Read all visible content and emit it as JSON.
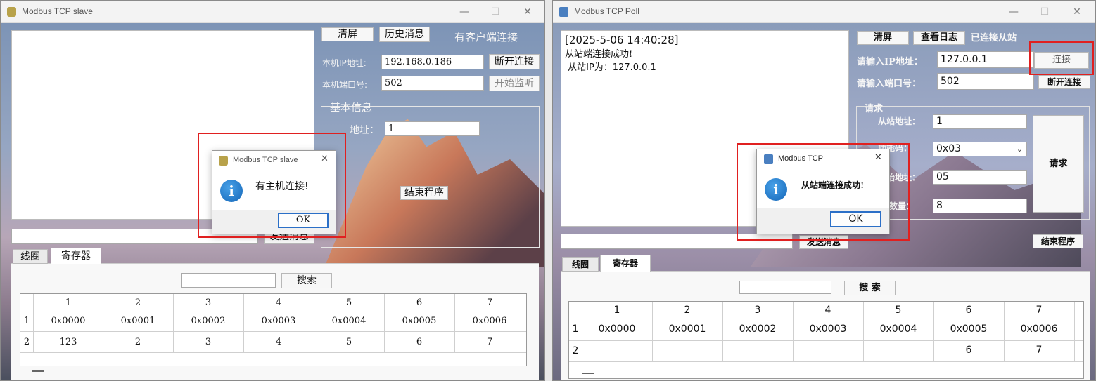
{
  "left_window": {
    "title": "Modbus TCP slave",
    "buttons": {
      "clear": "清屏",
      "history": "历史消息",
      "disconnect": "断开连接",
      "start_listen": "开始监听",
      "end_program": "结束程序",
      "send": "发送消息",
      "search": "搜索"
    },
    "status": "有客户端连接",
    "ip_label": "本机IP地址:",
    "ip_value": "192.168.0.186",
    "port_label": "本机端口号:",
    "port_value": "502",
    "group_title": "基本信息",
    "address_label": "地址：",
    "address_value": "1",
    "tabs": [
      "线圈",
      "寄存器"
    ],
    "table": {
      "columns": [
        "1",
        "2",
        "3",
        "4",
        "5",
        "6",
        "7"
      ],
      "row_labels": [
        "1",
        "2"
      ],
      "rows": [
        [
          "0x0000",
          "0x0001",
          "0x0002",
          "0x0003",
          "0x0004",
          "0x0005",
          "0x0006"
        ],
        [
          "123",
          "2",
          "3",
          "4",
          "5",
          "6",
          "7"
        ]
      ]
    },
    "dialog": {
      "title": "Modbus TCP slave",
      "message": "有主机连接!",
      "ok": "OK"
    }
  },
  "right_window": {
    "title": "Modbus TCP Poll",
    "log": [
      "[2025-5-06 14:40:28]",
      "从站端连接成功!",
      " 从站IP为：127.0.0.1"
    ],
    "buttons": {
      "clear": "清屏",
      "view_log": "查看日志",
      "connect": "连接",
      "disconnect": "断开连接",
      "request": "请求",
      "send": "发送消息",
      "end_program": "结束程序",
      "search": "搜 索"
    },
    "status": "已连接从站",
    "ip_label": "请输入IP地址：",
    "ip_value": "127.0.0.1",
    "port_label": "请输入端口号：",
    "port_value": "502",
    "group_title": "请求",
    "slave_label": "从站地址：",
    "slave_value": "1",
    "func_label": "功能码：",
    "func_value": "0x03",
    "start_label": "起始地址：",
    "start_value": "05",
    "qty_label": "数量：",
    "qty_value": "8",
    "tabs": [
      "线圈",
      "寄存器"
    ],
    "table": {
      "columns": [
        "1",
        "2",
        "3",
        "4",
        "5",
        "6",
        "7"
      ],
      "row_labels": [
        "1",
        "2"
      ],
      "rows": [
        [
          "0x0000",
          "0x0001",
          "0x0002",
          "0x0003",
          "0x0004",
          "0x0005",
          "0x0006"
        ],
        [
          "",
          "",
          "",
          "",
          "",
          "6",
          "7"
        ]
      ]
    },
    "dialog": {
      "title": "Modbus TCP",
      "message": "从站端连接成功!",
      "ok": "OK"
    }
  },
  "colors": {
    "highlight": "#e02020",
    "info_icon": "#1a6fc4"
  }
}
